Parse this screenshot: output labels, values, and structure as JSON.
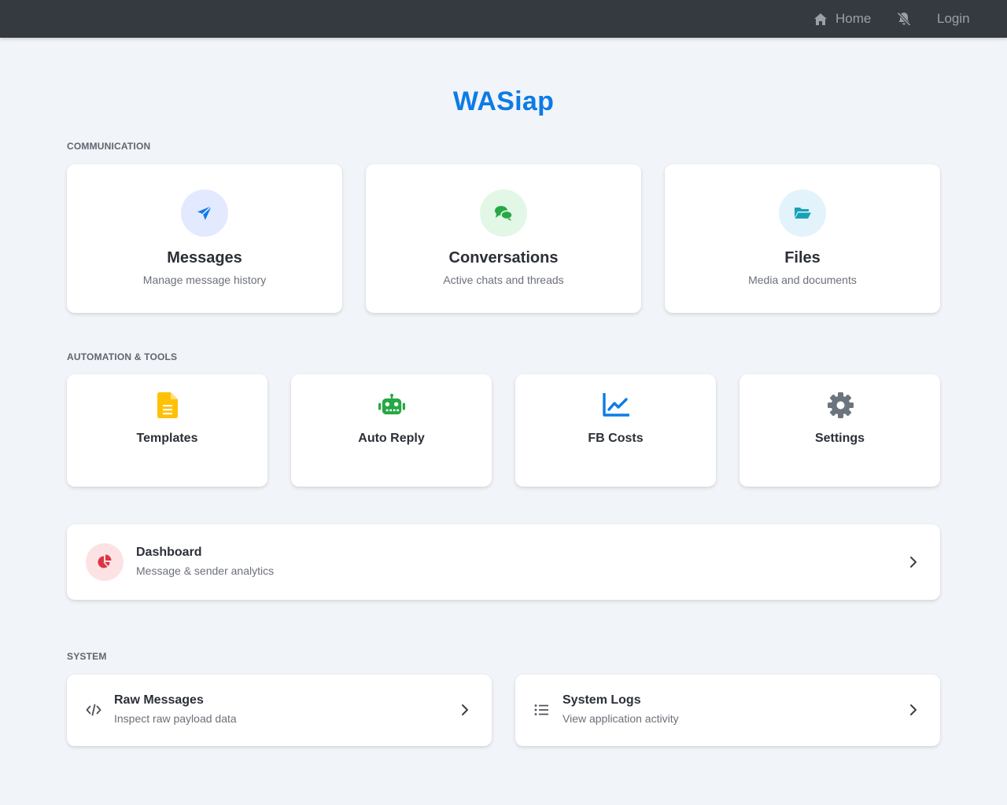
{
  "navbar": {
    "home_label": "Home",
    "login_label": "Login",
    "text_color": "#9aa0a6",
    "background": "#343a40"
  },
  "app": {
    "title": "WASiap",
    "title_color": "#0d7be6"
  },
  "sections": {
    "communication": "COMMUNICATION",
    "automation": "AUTOMATION & TOOLS",
    "system": "SYSTEM"
  },
  "communication_cards": [
    {
      "title": "Messages",
      "subtitle": "Manage message history",
      "icon": "paper-plane-icon",
      "icon_color": "#0d7be6",
      "bg_color": "#e3e9ff"
    },
    {
      "title": "Conversations",
      "subtitle": "Active chats and threads",
      "icon": "chat-bubbles-icon",
      "icon_color": "#28a745",
      "bg_color": "#e2f7e6"
    },
    {
      "title": "Files",
      "subtitle": "Media and documents",
      "icon": "folder-open-icon",
      "icon_color": "#17a2b8",
      "bg_color": "#e3f3fb"
    }
  ],
  "tool_cards": [
    {
      "title": "Templates",
      "icon": "file-text-icon",
      "icon_color": "#ffc107"
    },
    {
      "title": "Auto Reply",
      "icon": "robot-icon",
      "icon_color": "#28a745"
    },
    {
      "title": "FB Costs",
      "icon": "line-chart-icon",
      "icon_color": "#0d7be6"
    },
    {
      "title": "Settings",
      "icon": "gear-icon",
      "icon_color": "#6c757d"
    }
  ],
  "dashboard": {
    "title": "Dashboard",
    "subtitle": "Message & sender analytics",
    "icon": "pie-chart-icon",
    "icon_color": "#dc3545",
    "bg_color": "#fde2e4"
  },
  "system_cards": [
    {
      "title": "Raw Messages",
      "subtitle": "Inspect raw payload data",
      "icon": "code-icon"
    },
    {
      "title": "System Logs",
      "subtitle": "View application activity",
      "icon": "list-icon"
    }
  ]
}
